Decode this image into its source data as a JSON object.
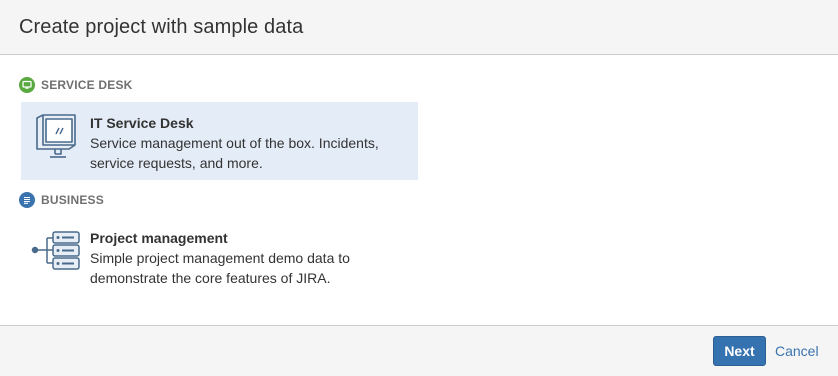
{
  "dialog": {
    "title": "Create project with sample data"
  },
  "sections": [
    {
      "label": "SERVICE DESK",
      "icon": "monitor-icon",
      "color": "#59a840",
      "items": [
        {
          "title": "IT Service Desk",
          "description": "Service management out of the box. Incidents, service requests, and more.",
          "selected": true,
          "icon": "computer-monitor-icon"
        }
      ]
    },
    {
      "label": "BUSINESS",
      "icon": "list-icon",
      "color": "#3b73af",
      "items": [
        {
          "title": "Project management",
          "description": "Simple project management demo data to demonstrate the core features of JIRA.",
          "selected": false,
          "icon": "hierarchy-tree-icon"
        }
      ]
    }
  ],
  "footer": {
    "next_label": "Next",
    "cancel_label": "Cancel"
  },
  "colors": {
    "primary": "#3572b0",
    "selected_bg": "#e4ecf7",
    "link": "#3b73af"
  }
}
